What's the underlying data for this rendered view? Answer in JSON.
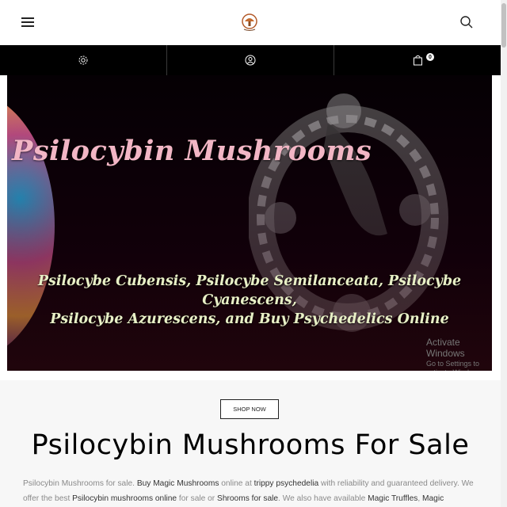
{
  "header": {
    "menu_icon": "hamburger-menu-icon",
    "logo_icon": "mushroom-logo-icon",
    "search_icon": "search-icon"
  },
  "toolbar": {
    "items": [
      {
        "icon": "gear-icon"
      },
      {
        "icon": "user-icon"
      },
      {
        "icon": "shopping-bag-icon",
        "count": "0"
      }
    ]
  },
  "hero": {
    "title": "Psilocybin Mushrooms",
    "subtitle_line1": "Psilocybe Cubensis, Psilocybe Semilanceata, Psilocybe Cyanescens,",
    "subtitle_line2": "Psilocybe Azurescens, and Buy Psychedelics Online",
    "watermark_line1": "Activate Windows",
    "watermark_line2": "Go to Settings to activate Windows."
  },
  "content": {
    "shop_button": "SHOP NOW",
    "heading": "Psilocybin Mushrooms For Sale",
    "intro": [
      {
        "text": "Psilocybin Mushrooms for sale. ",
        "link": false
      },
      {
        "text": "Buy Magic Mushrooms",
        "link": true
      },
      {
        "text": " online at ",
        "link": false
      },
      {
        "text": "trippy psychedelia",
        "link": true
      },
      {
        "text": " with reliability and guaranteed delivery. We offer the best ",
        "link": false
      },
      {
        "text": "Psilocybin mushrooms online",
        "link": true
      },
      {
        "text": " for sale or ",
        "link": false
      },
      {
        "text": "Shrooms for sale",
        "link": true
      },
      {
        "text": ". We also have available ",
        "link": false
      },
      {
        "text": "Magic Truffles",
        "link": true
      },
      {
        "text": ", ",
        "link": false
      },
      {
        "text": "Magic",
        "link": true
      }
    ]
  },
  "colors": {
    "toolbar_bg": "#000000",
    "hero_title": "#f2b6c5",
    "hero_subtitle": "#e8f0c6"
  }
}
